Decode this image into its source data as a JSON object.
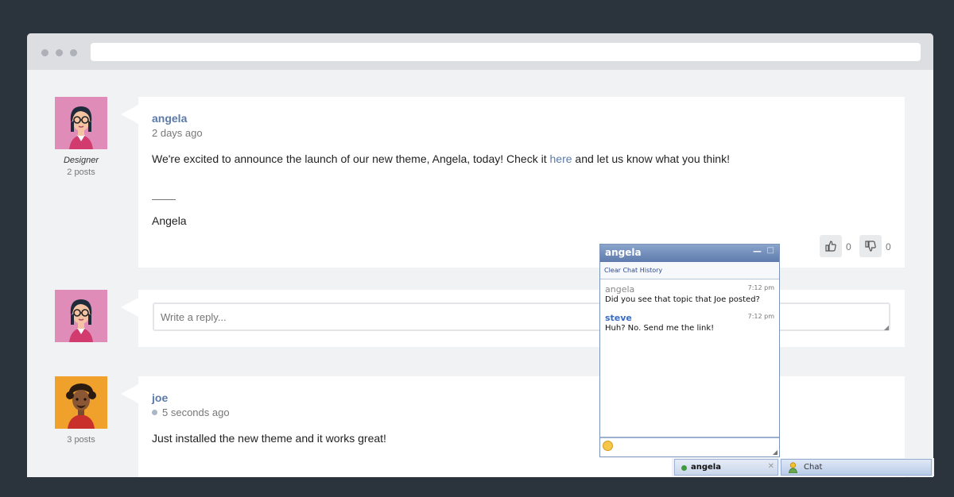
{
  "browser": {
    "address_value": ""
  },
  "posts": [
    {
      "username": "angela",
      "time": "2 days ago",
      "body_before": "We're excited to announce the launch of our new theme, Angela, today! Check it ",
      "link_text": "here",
      "body_after": " and let us know what you think!",
      "signature": "Angela",
      "role": "Designer",
      "post_count": "2 posts",
      "likes": "0",
      "dislikes": "0"
    },
    {
      "username": "joe",
      "time": "5 seconds ago",
      "body": "Just installed the new theme and it works great!",
      "post_count": "3 posts"
    }
  ],
  "reply": {
    "placeholder": "Write a reply..."
  },
  "chat": {
    "title": "angela",
    "minimize_glyph": "—",
    "close_glyph": "□",
    "clear_history": "Clear Chat History",
    "messages": [
      {
        "user": "angela",
        "time": "7:12 pm",
        "text": "Did you see that topic that Joe posted?"
      },
      {
        "user": "steve",
        "time": "7:12 pm",
        "text": "Huh? No. Send me the link!"
      }
    ]
  },
  "taskbar": {
    "active_tab": "angela",
    "close_glyph": "✕",
    "chat_label": "Chat"
  },
  "colors": {
    "link": "#5b7aa8",
    "background": "#2b343d",
    "page": "#f1f2f4",
    "chat_header": "#5e7bac"
  }
}
